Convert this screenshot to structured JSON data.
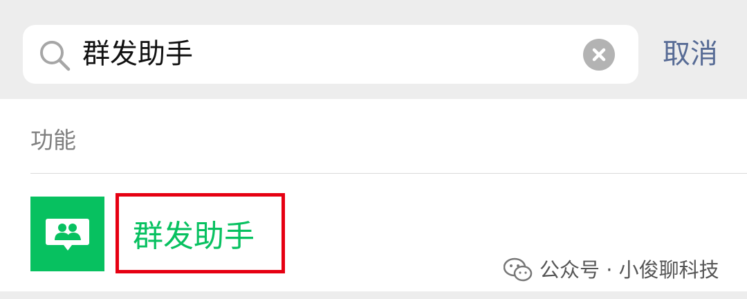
{
  "search": {
    "query": "群发助手",
    "cancel_label": "取消"
  },
  "results": {
    "section_label": "功能",
    "items": [
      {
        "title": "群发助手",
        "icon": "group-chat-icon"
      }
    ]
  },
  "watermark": {
    "text": "公众号 · 小俊聊科技",
    "icon": "wechat-icon"
  },
  "colors": {
    "accent_green": "#07c160",
    "cancel_blue": "#576b95",
    "highlight_red": "#e60012",
    "search_bar_bg": "#ededed"
  }
}
